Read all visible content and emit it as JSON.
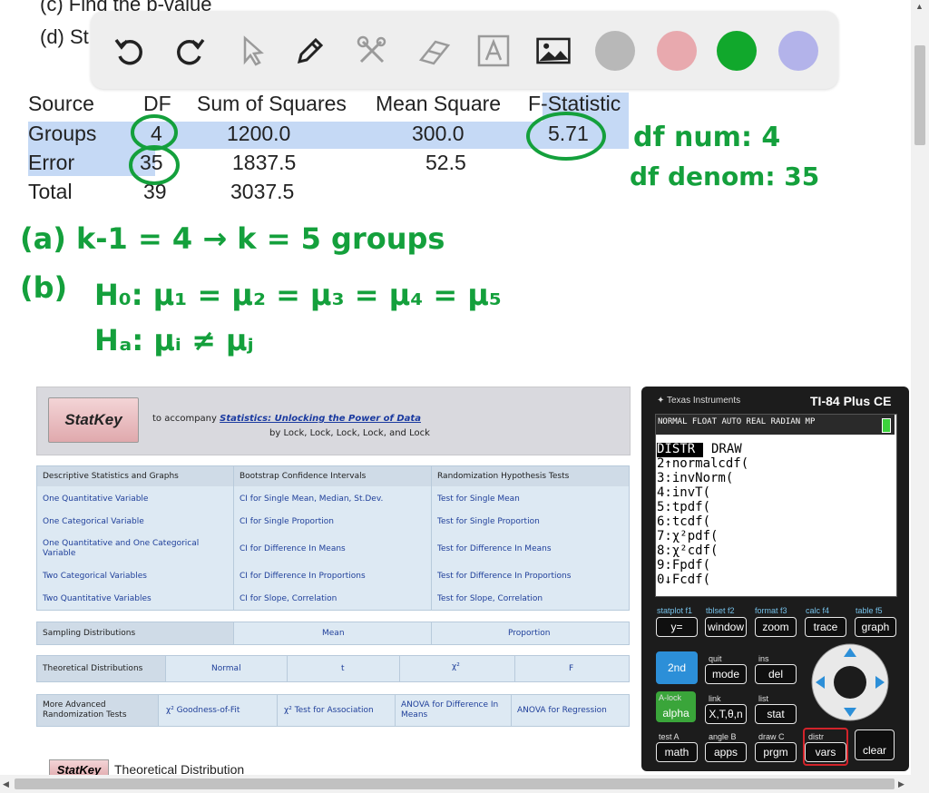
{
  "top_cut": {
    "line_c": "(c) Find the p-value",
    "line_d": "(d) St"
  },
  "toolbar": {
    "tools": [
      "undo-icon",
      "redo-icon",
      "pointer-icon",
      "pen-icon",
      "tools-icon",
      "eraser-icon",
      "text-icon",
      "image-icon"
    ],
    "swatches": [
      "#b8b8b8",
      "#e8a9ae",
      "#11a82c",
      "#b3b3ea"
    ]
  },
  "anova": {
    "headers": [
      "Source",
      "DF",
      "Sum of Squares",
      "Mean Square",
      "F-Statistic"
    ],
    "rows": [
      {
        "source": "Groups",
        "df": "4",
        "ss": "1200.0",
        "ms": "300.0",
        "f": "5.71"
      },
      {
        "source": "Error",
        "df": "35",
        "ss": "1837.5",
        "ms": "52.5",
        "f": ""
      },
      {
        "source": "Total",
        "df": "39",
        "ss": "3037.5",
        "ms": "",
        "f": ""
      }
    ]
  },
  "handwriting": {
    "df_num": "df num: 4",
    "df_denom": "df denom: 35",
    "part_a": "(a)  k-1 = 4  →  k = 5 groups",
    "part_b": "(b)",
    "h0": "H₀: μ₁ = μ₂ = μ₃ = μ₄ = μ₅",
    "ha": "Hₐ: μᵢ ≠ μⱼ"
  },
  "statkey": {
    "logo": "StatKey",
    "accompany": "to accompany",
    "book": "Statistics: Unlocking the Power of Data",
    "authors": "by Lock, Lock, Lock, Lock, and Lock",
    "columns": [
      "Descriptive Statistics and Graphs",
      "Bootstrap Confidence Intervals",
      "Randomization Hypothesis Tests"
    ],
    "rows": [
      [
        "One Quantitative Variable",
        "CI for Single Mean, Median, St.Dev.",
        "Test for Single Mean"
      ],
      [
        "One Categorical Variable",
        "CI for Single Proportion",
        "Test for Single Proportion"
      ],
      [
        "One Quantitative and One Categorical Variable",
        "CI for Difference In Means",
        "Test for Difference In Means"
      ],
      [
        "Two Categorical Variables",
        "CI for Difference In Proportions",
        "Test for Difference In Proportions"
      ],
      [
        "Two Quantitative Variables",
        "CI for Slope, Correlation",
        "Test for Slope, Correlation"
      ]
    ],
    "sampling": {
      "label": "Sampling Distributions",
      "mean": "Mean",
      "proportion": "Proportion"
    },
    "theoretical": {
      "label": "Theoretical Distributions",
      "items": [
        "Normal",
        "t",
        "χ²",
        "F"
      ]
    },
    "advanced": {
      "label": "More Advanced Randomization Tests",
      "items": [
        "χ² Goodness-of-Fit",
        "χ² Test for Association",
        "ANOVA for Difference In Means",
        "ANOVA for Regression"
      ]
    },
    "bottom_logo": "StatKey",
    "bottom_title": "Theoretical Distribution"
  },
  "calculator": {
    "brand": "Texas Instruments",
    "model": "TI-84 Plus CE",
    "status": "NORMAL FLOAT AUTO REAL RADIAN MP",
    "menu_tabs": [
      "DISTR",
      "DRAW"
    ],
    "menu": [
      "2↑normalcdf(",
      "3:invNorm(",
      "4:invT(",
      "5:tpdf(",
      "6:tcdf(",
      "7:χ²pdf(",
      "8:χ²cdf(",
      "9:Fpdf(",
      "0↓Fcdf("
    ],
    "fkeys": [
      {
        "top": "statplot f1",
        "label": "y="
      },
      {
        "top": "tblset f2",
        "label": "window"
      },
      {
        "top": "format f3",
        "label": "zoom"
      },
      {
        "top": "calc f4",
        "label": "trace"
      },
      {
        "top": "table f5",
        "label": "graph"
      }
    ],
    "row2": [
      {
        "top": "",
        "label": "2nd"
      },
      {
        "top": "quit",
        "label": "mode"
      },
      {
        "top": "ins",
        "label": "del"
      }
    ],
    "row3": [
      {
        "top": "A-lock",
        "label": "alpha"
      },
      {
        "top": "link",
        "label": "X,T,θ,n"
      },
      {
        "top": "list",
        "label": "stat"
      }
    ],
    "row4": [
      {
        "top": "test A",
        "label": "math"
      },
      {
        "top": "angle B",
        "label": "apps"
      },
      {
        "top": "draw C",
        "label": "prgm"
      },
      {
        "top": "distr",
        "label": "vars"
      },
      {
        "top": "",
        "label": "clear"
      }
    ]
  }
}
